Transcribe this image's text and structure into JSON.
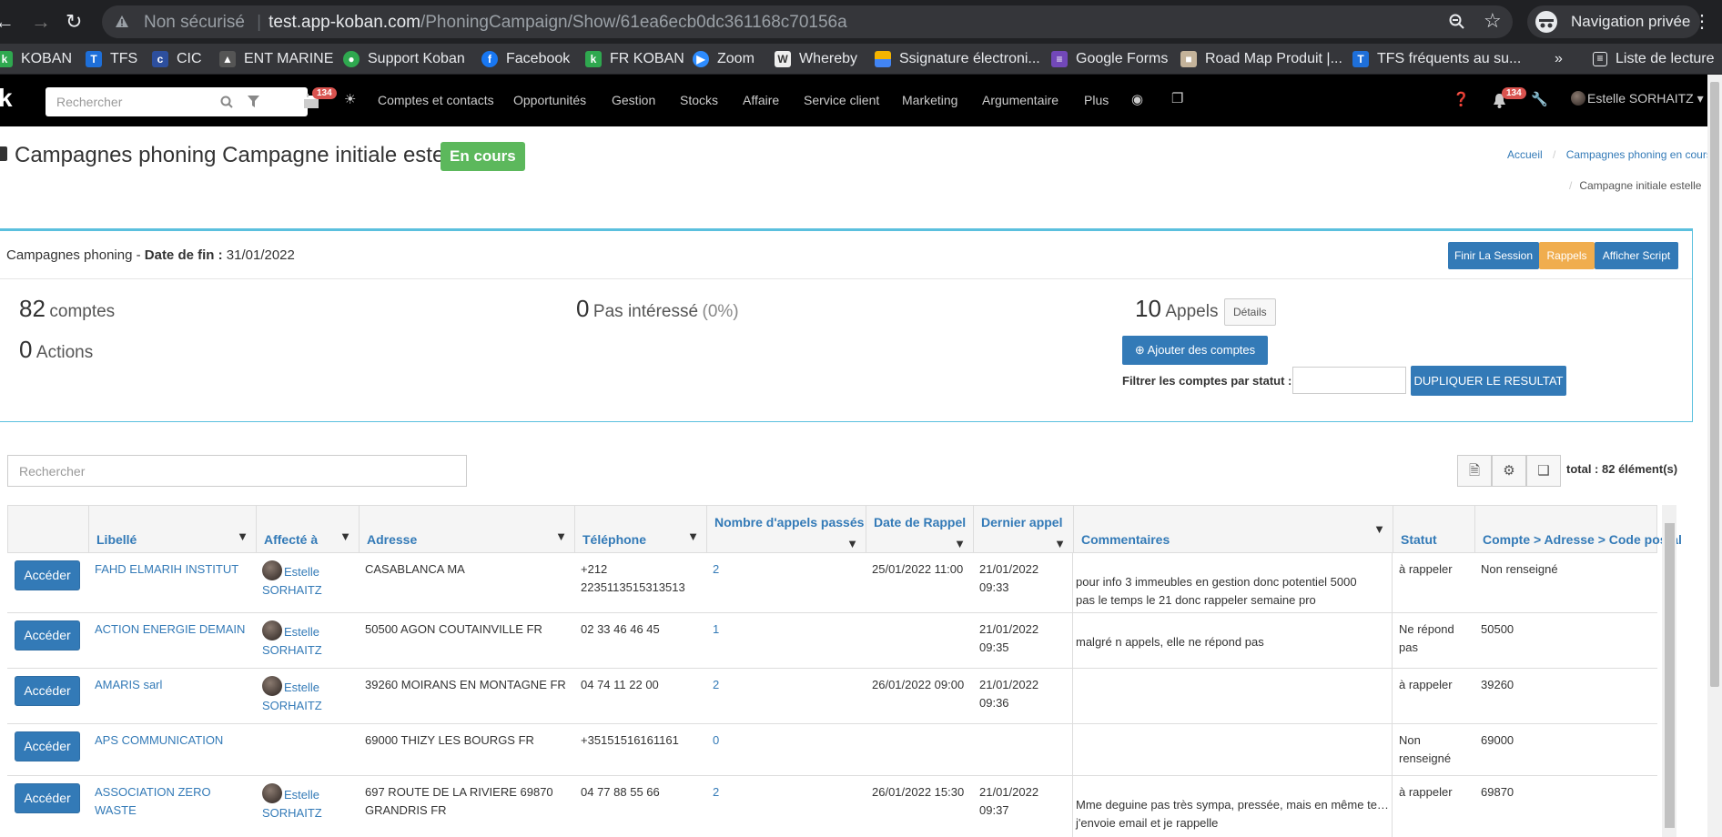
{
  "browser": {
    "security": "Non sécurisé",
    "url_host": "test.app-koban.com",
    "url_path": "/PhoningCampaign/Show/61ea6ecb0dc361168c70156a",
    "private_label": "Navigation privée",
    "bookmarks": [
      "KOBAN",
      "TFS",
      "CIC",
      "ENT MARINE",
      "Support Koban",
      "Facebook",
      "FR KOBAN",
      "Zoom",
      "Whereby",
      "Ssignature électroni...",
      "Google Forms",
      "Road Map Produit |...",
      "TFS fréquents au su..."
    ],
    "reading_list": "Liste de lecture",
    "more": "»"
  },
  "appnav": {
    "search_placeholder": "Rechercher",
    "badge_count": "134",
    "menu": [
      "Comptes et contacts",
      "Opportunités",
      "Gestion",
      "Stocks",
      "Affaire",
      "Service client",
      "Marketing",
      "Argumentaire",
      "Plus"
    ],
    "notif_count": "134",
    "user": "Estelle SORHAITZ"
  },
  "page": {
    "title": "Campagnes phoning Campagne initiale estelle",
    "status": "En cours",
    "breadcrumb": [
      "Accueil",
      "Campagnes phoning en cours",
      "Campagne initiale estelle"
    ]
  },
  "panel": {
    "heading_prefix": "Campagnes phoning - ",
    "date_label": "Date de fin :",
    "date_value": " 31/01/2022",
    "buttons": {
      "finish": "Finir La Session",
      "reminders": "Rappels",
      "script": "Afficher Script"
    },
    "stats": {
      "accounts_num": "82",
      "accounts_lbl": "comptes",
      "actions_num": "0",
      "actions_lbl": "Actions",
      "notint_num": "0",
      "notint_lbl": "Pas intéressé",
      "notint_pct": "(0%)",
      "calls_num": "10",
      "calls_lbl": "Appels",
      "details": "Détails"
    },
    "add_accounts": "Ajouter des comptes",
    "filter_label": "Filtrer les comptes par statut :",
    "duplicate": "DUPLIQUER LE RESULTAT"
  },
  "list": {
    "search_placeholder": "Rechercher",
    "total": "total : 82 élément(s)"
  },
  "table": {
    "headers": [
      "Libellé",
      "Affecté à",
      "Adresse",
      "Téléphone",
      "Nombre d'appels passés",
      "Date de Rappel",
      "Dernier appel",
      "Commentaires",
      "Statut",
      "Compte > Adresse > Code postal"
    ],
    "action_label": "Accéder",
    "rows": [
      {
        "name": "FAHD ELMARIH INSTITUT",
        "assigned1": "Estelle",
        "assigned2": "SORHAITZ",
        "address1": "CASABLANCA MA",
        "address2": "",
        "phone1": "+212",
        "phone2": "2235113515313513",
        "calls": "2",
        "recall": "25/01/2022 11:00",
        "last1": "21/01/2022",
        "last2": "09:33",
        "comment1": "pour info 3 immeubles en gestion donc potentiel 5000",
        "comment2": "pas le temps le 21 donc rappeler semaine pro",
        "status1": "à rappeler",
        "status2": "",
        "postal": "Non renseigné"
      },
      {
        "name": "ACTION ENERGIE DEMAIN",
        "assigned1": "Estelle",
        "assigned2": "SORHAITZ",
        "address1": "50500 AGON COUTAINVILLE FR",
        "address2": "",
        "phone1": "02 33 46 46 45",
        "phone2": "",
        "calls": "1",
        "recall": "",
        "last1": "21/01/2022",
        "last2": "09:35",
        "comment1": "malgré n appels, elle ne répond pas",
        "comment2": "",
        "status1": "Ne répond",
        "status2": "pas",
        "postal": "50500"
      },
      {
        "name": "AMARIS sarl",
        "assigned1": "Estelle",
        "assigned2": "SORHAITZ",
        "address1": "39260 MOIRANS EN MONTAGNE FR",
        "address2": "",
        "phone1": "04 74 11 22 00",
        "phone2": "",
        "calls": "2",
        "recall": "26/01/2022 09:00",
        "last1": "21/01/2022",
        "last2": "09:36",
        "comment1": "",
        "comment2": "",
        "status1": "à rappeler",
        "status2": "",
        "postal": "39260"
      },
      {
        "name": "APS COMMUNICATION",
        "assigned1": "",
        "assigned2": "",
        "address1": "69000 THIZY LES BOURGS FR",
        "address2": "",
        "phone1": "+35151516161161",
        "phone2": "",
        "calls": "0",
        "recall": "",
        "last1": "",
        "last2": "",
        "comment1": "",
        "comment2": "",
        "status1": "Non",
        "status2": "renseigné",
        "postal": "69000"
      },
      {
        "name": "ASSOCIATION ZERO WASTE",
        "assigned1": "Estelle",
        "assigned2": "SORHAITZ",
        "address1": "697 ROUTE DE LA RIVIERE 69870",
        "address2": "GRANDRIS FR",
        "phone1": "04 77 88 55 66",
        "phone2": "",
        "calls": "2",
        "recall": "26/01/2022 15:30",
        "last1": "21/01/2022",
        "last2": "09:37",
        "comment1": "Mme deguine pas très sympa, pressée, mais en même te…",
        "comment2": "j'envoie email et je rappelle",
        "status1": "à rappeler",
        "status2": "",
        "postal": "69870"
      }
    ]
  }
}
